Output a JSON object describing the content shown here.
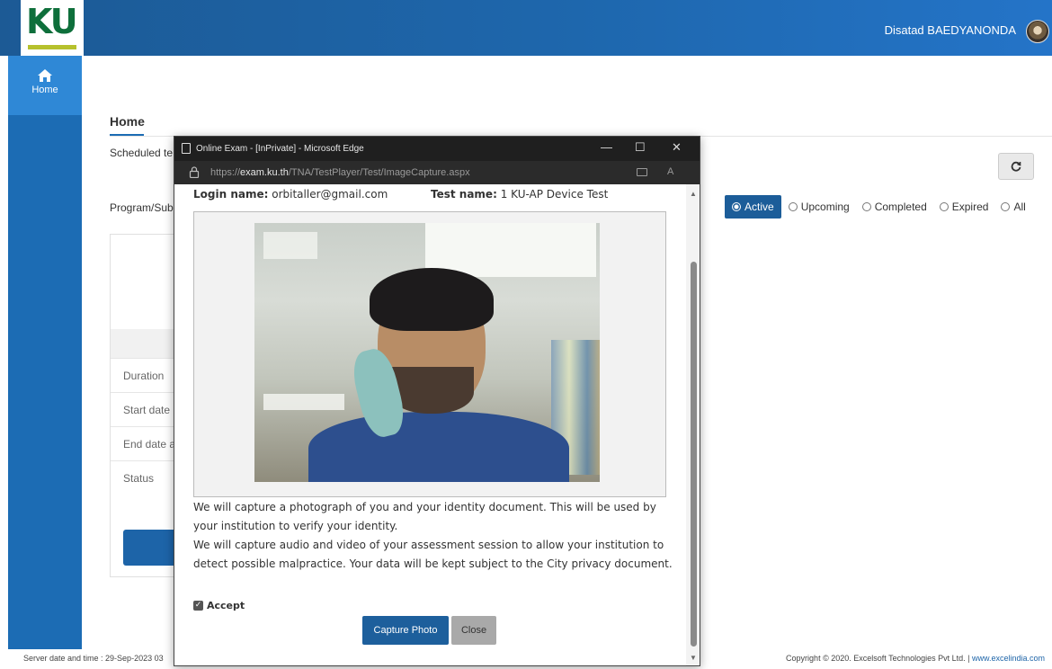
{
  "header": {
    "logo_text": "KU",
    "user_name": "Disatad BAEDYANONDA"
  },
  "sidebar": {
    "items": [
      {
        "label": "Home",
        "icon": "home-icon"
      }
    ]
  },
  "main": {
    "title": "Home",
    "scheduled_label": "Scheduled te",
    "program_label": "Program/Sub",
    "filters": {
      "selected": "Active",
      "options": [
        "Active",
        "Upcoming",
        "Completed",
        "Expired",
        "All"
      ]
    },
    "card_rows": [
      "Duration",
      "Start date",
      "End date a",
      "Status"
    ]
  },
  "footer": {
    "server_time": "Server date and time : 29-Sep-2023 03",
    "copyright": "Copyright © 2020. Excelsoft Technologies Pvt Ltd. | ",
    "link": "www.excelindia.com"
  },
  "popup": {
    "window_title": "Online Exam - [InPrivate] - Microsoft Edge",
    "url_prefix": "https://",
    "url_host": "exam.ku.th",
    "url_path": "/TNA/TestPlayer/Test/ImageCapture.aspx",
    "read_aloud": "A",
    "login_label": "Login name:",
    "login_value": "orbitaller@gmail.com",
    "test_label": "Test name:",
    "test_value": "1 KU-AP Device Test",
    "para1": "We will capture a photograph of you and your identity document. This will be used by your institution to verify your identity.",
    "para2": "We will capture audio and video of your assessment session to allow your institution to detect possible malpractice. Your data will be kept subject to the City privacy document.",
    "accept_label": "Accept",
    "accept_checked": true,
    "capture_button": "Capture Photo",
    "close_button": "Close"
  },
  "colors": {
    "header": "#1e67ad",
    "sidebar": "#1c6cb4",
    "primary_button": "#1d5f9c"
  }
}
